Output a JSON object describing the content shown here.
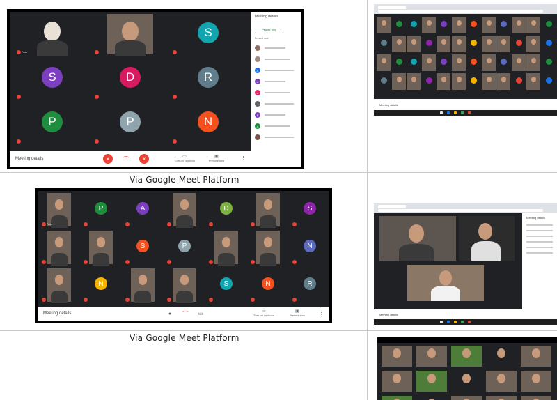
{
  "captions": {
    "first": "Via Google Meet Platform",
    "second": "Via Google Meet Platform"
  },
  "meet1": {
    "meeting_details": "Meeting details",
    "panel_title": "Meeting details",
    "panel_tab": "People (xx)",
    "present_label": "Present now",
    "captions_btn": "Turn on captions",
    "present_btn": "Present now",
    "tiles": [
      {
        "kind": "photo",
        "name": "You"
      },
      {
        "kind": "video",
        "name": ""
      },
      {
        "kind": "letter",
        "letter": "S",
        "color": "#12a4af",
        "name": ""
      },
      {
        "kind": "letter",
        "letter": "S",
        "color": "#7b3fbf",
        "name": ""
      },
      {
        "kind": "letter",
        "letter": "D",
        "color": "#d81b60",
        "name": ""
      },
      {
        "kind": "letter",
        "letter": "R",
        "color": "#607d8b",
        "name": ""
      },
      {
        "kind": "letter",
        "letter": "P",
        "color": "#1e8e3e",
        "name": ""
      },
      {
        "kind": "letter",
        "letter": "P",
        "color": "#90a4ae",
        "name": ""
      },
      {
        "kind": "letter",
        "letter": "N",
        "color": "#f4511e",
        "name": ""
      }
    ],
    "people": [
      {
        "initial": "",
        "color": "#8d6e63"
      },
      {
        "initial": "",
        "color": "#a1887f"
      },
      {
        "initial": "A",
        "color": "#1a73e8"
      },
      {
        "initial": "A",
        "color": "#7b3fbf"
      },
      {
        "initial": "A",
        "color": "#e91e63"
      },
      {
        "initial": "J",
        "color": "#5f6368"
      },
      {
        "initial": "P",
        "color": "#7b3fbf"
      },
      {
        "initial": "A",
        "color": "#1e8e3e"
      },
      {
        "initial": "",
        "color": "#795548"
      }
    ]
  },
  "meet2": {
    "meeting_details": "Meeting details",
    "captions_btn": "Turn on captions",
    "present_btn": "Present now",
    "tiles": [
      {
        "kind": "video",
        "name": "You"
      },
      {
        "kind": "letter",
        "letter": "P",
        "color": "#1e8e3e",
        "name": ""
      },
      {
        "kind": "letter",
        "letter": "A",
        "color": "#7b3fbf",
        "name": ""
      },
      {
        "kind": "video",
        "name": ""
      },
      {
        "kind": "letter",
        "letter": "D",
        "color": "#7cb342",
        "name": ""
      },
      {
        "kind": "video",
        "name": ""
      },
      {
        "kind": "letter",
        "letter": "S",
        "color": "#8e24aa",
        "name": ""
      },
      {
        "kind": "video",
        "name": ""
      },
      {
        "kind": "video",
        "name": ""
      },
      {
        "kind": "letter",
        "letter": "S",
        "color": "#f4511e",
        "name": ""
      },
      {
        "kind": "letter",
        "letter": "P",
        "color": "#90a4ae",
        "name": ""
      },
      {
        "kind": "video",
        "name": ""
      },
      {
        "kind": "video",
        "name": ""
      },
      {
        "kind": "letter",
        "letter": "N",
        "color": "#5c6bc0",
        "name": ""
      },
      {
        "kind": "video",
        "name": ""
      },
      {
        "kind": "letter",
        "letter": "N",
        "color": "#f4b400",
        "name": ""
      },
      {
        "kind": "video",
        "name": ""
      },
      {
        "kind": "video",
        "name": ""
      },
      {
        "kind": "letter",
        "letter": "S",
        "color": "#12a4af",
        "name": ""
      },
      {
        "kind": "letter",
        "letter": "N",
        "color": "#f4511e",
        "name": ""
      },
      {
        "kind": "letter",
        "letter": "R",
        "color": "#607d8b",
        "name": ""
      }
    ]
  },
  "shot_right1": {
    "meeting_details": "Meeting details"
  },
  "shot_right2": {
    "meeting_details": "Meeting details",
    "panel_title": "Meeting details"
  },
  "colors": {
    "meet_bg": "#202124",
    "accent_red": "#ea4335",
    "meet_green": "#188038"
  }
}
